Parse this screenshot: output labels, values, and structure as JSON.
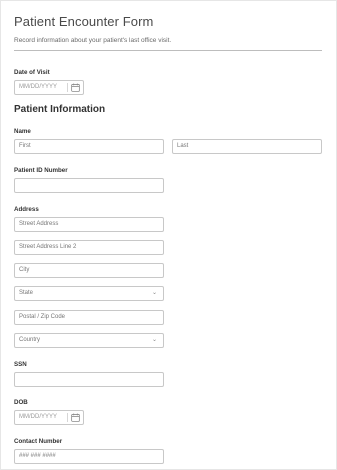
{
  "form": {
    "title": "Patient Encounter Form",
    "subtitle": "Record information about your patient's last office visit."
  },
  "date_of_visit": {
    "label": "Date of Visit",
    "placeholder": "MM/DD/YYYY"
  },
  "section_title": "Patient Information",
  "name": {
    "label": "Name",
    "first_placeholder": "First",
    "last_placeholder": "Last"
  },
  "patient_id": {
    "label": "Patient ID Number",
    "value": ""
  },
  "address": {
    "label": "Address",
    "street_placeholder": "Street Address",
    "street2_placeholder": "Street Address Line 2",
    "city_placeholder": "City",
    "state_placeholder": "State",
    "postal_placeholder": "Postal / Zip Code",
    "country_placeholder": "Country"
  },
  "ssn": {
    "label": "SSN",
    "value": ""
  },
  "dob": {
    "label": "DOB",
    "placeholder": "MM/DD/YYYY"
  },
  "contact": {
    "label": "Contact Number",
    "placeholder": "### ### ####"
  },
  "icons": {
    "calendar": "calendar-icon",
    "chevron": "chevron-down-icon"
  }
}
